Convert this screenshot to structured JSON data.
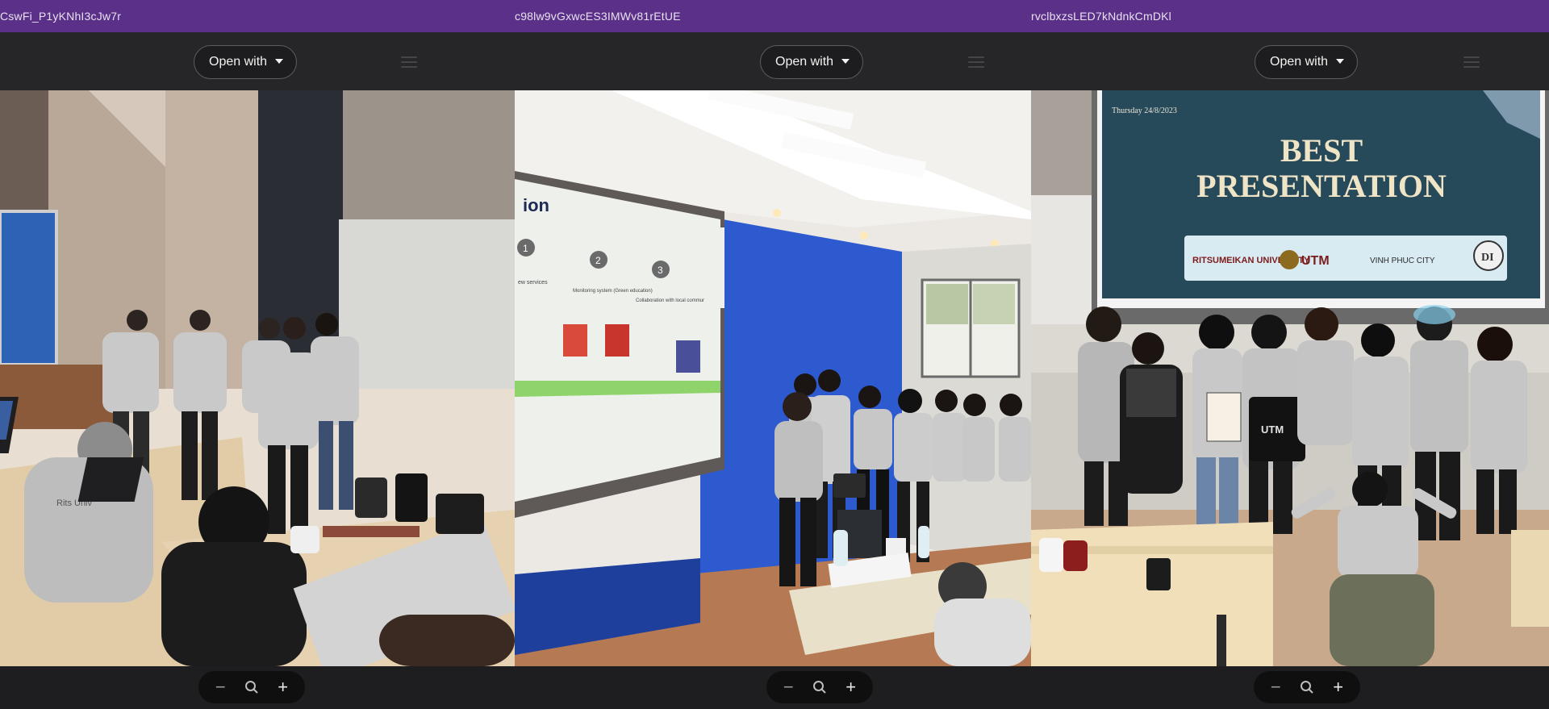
{
  "viewers": [
    {
      "title": "CswFi_P1yKNhI3cJw7r",
      "open_with_label": "Open with",
      "icons": {
        "dropdown": "caret-down-icon",
        "menu": "hamburger-menu-icon",
        "zoom_out": "minus-icon",
        "zoom_reset": "magnifier-icon",
        "zoom_in": "plus-icon"
      },
      "zoom_out": "−",
      "zoom_in": "+",
      "photo_shirt_text": "Rits Univ"
    },
    {
      "title": "c98lw9vGxwcES3IMWv81rEtUE",
      "open_with_label": "Open with",
      "icons": {
        "dropdown": "caret-down-icon",
        "menu": "hamburger-menu-icon",
        "zoom_out": "minus-icon",
        "zoom_reset": "magnifier-icon",
        "zoom_in": "plus-icon"
      },
      "zoom_out": "−",
      "zoom_in": "+",
      "slide_heading": "ion",
      "slide_steps": [
        {
          "num": "1",
          "text": "ew services"
        },
        {
          "num": "2",
          "text": "Monitoring system (Green education)"
        },
        {
          "num": "3",
          "text": "Collaboration with local community"
        }
      ]
    },
    {
      "title": "rvclbxzsLED7kNdnkCmDKl",
      "open_with_label": "Open with",
      "icons": {
        "dropdown": "caret-down-icon",
        "menu": "hamburger-menu-icon",
        "zoom_out": "minus-icon",
        "zoom_reset": "magnifier-icon",
        "zoom_in": "plus-icon"
      },
      "zoom_out": "−",
      "zoom_in": "+",
      "slide_date": "Thursday 24/8/2023",
      "slide_line1": "BEST",
      "slide_line2": "PRESENTATION",
      "slide_logos": [
        "RITSUMEIKAN UNIVERSITY",
        "UTM",
        "VINH PHUC CITY",
        "DI"
      ]
    }
  ],
  "colors": {
    "titlebar": "#5a3088",
    "toolbar": "#262628",
    "pill": "#1d1d1f"
  }
}
